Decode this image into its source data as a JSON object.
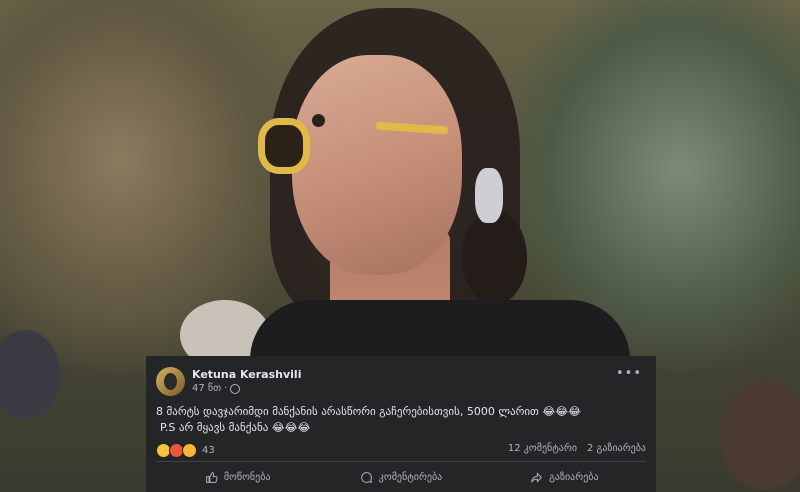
{
  "post": {
    "author": "Ketuna Kerashvili",
    "time": "47 წთ",
    "separator": "·",
    "more_label": "•••",
    "text_line1": "8 მარტს დავჯარიმდი მანქანის არასწორი გაჩერებისთვის, 5000 ლარით 😂😂😂",
    "text_line2": "P.S არ მყავს მანქანა 😂😂😂",
    "reaction_count": "43",
    "comments": "12 კომენტარი",
    "shares": "2 გაზიარება"
  },
  "actions": {
    "like": "მოწონება",
    "comment": "კომენტირება",
    "share": "გაზიარება"
  },
  "icons": [
    "globe-icon",
    "more-icon",
    "haha-reaction-icon",
    "angry-reaction-icon",
    "wow-reaction-icon",
    "like-icon",
    "comment-icon",
    "share-icon"
  ],
  "colors": {
    "card_bg": "#242526",
    "text": "#e4e6eb",
    "muted": "#b0b3b8",
    "haha": "#f7c33b",
    "angry": "#e9573f",
    "frame": "#e0b948"
  }
}
